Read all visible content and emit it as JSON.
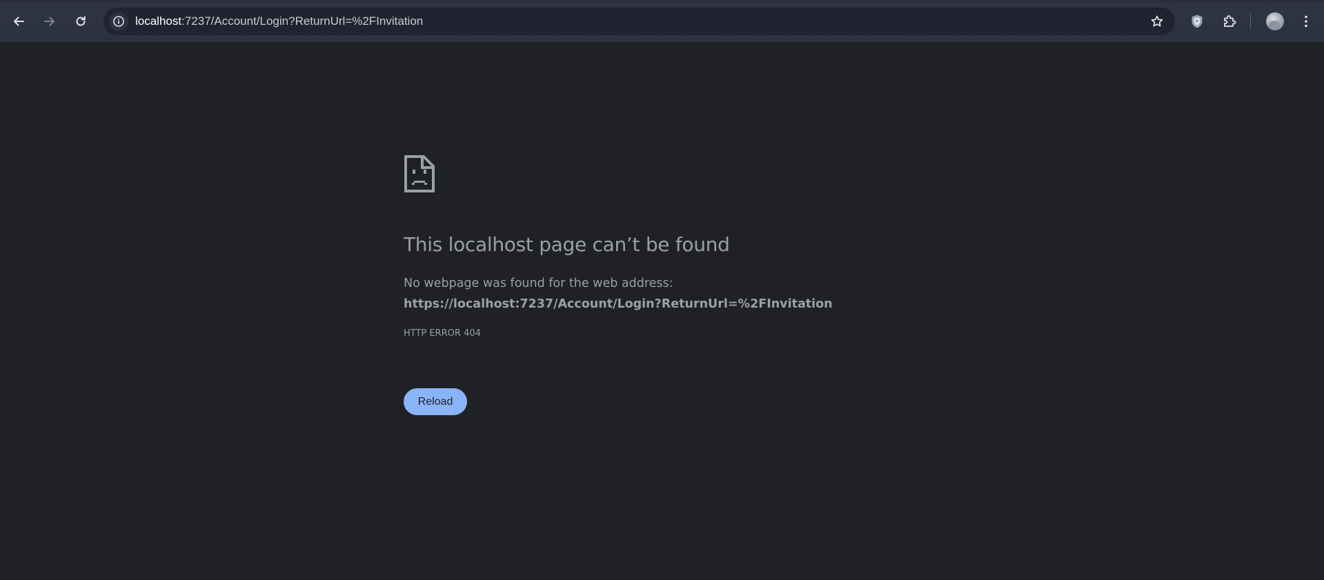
{
  "browser": {
    "address_bar": {
      "host": "localhost",
      "path": ":7237/Account/Login?ReturnUrl=%2FInvitation"
    },
    "icons": {
      "back": "arrow-left-icon",
      "forward": "arrow-right-icon",
      "reload": "reload-icon",
      "site_info": "info-icon",
      "bookmark": "star-icon",
      "extension_shield": "shield-icon",
      "extensions": "puzzle-icon",
      "profile": "avatar",
      "menu": "kebab-menu-icon"
    },
    "forward_enabled": false
  },
  "error_page": {
    "icon": "sad-page-icon",
    "title": "This localhost page can’t be found",
    "description_prefix": "No webpage was found for the web address: ",
    "url": "https://localhost:7237/Account/Login?ReturnUrl=%2FInvitation",
    "error_code": "HTTP ERROR 404",
    "reload_label": "Reload"
  },
  "colors": {
    "page_background": "#202124",
    "toolbar_background": "#2b3140",
    "text": "#9aa0a6",
    "button_accent": "#8ab4f8"
  }
}
